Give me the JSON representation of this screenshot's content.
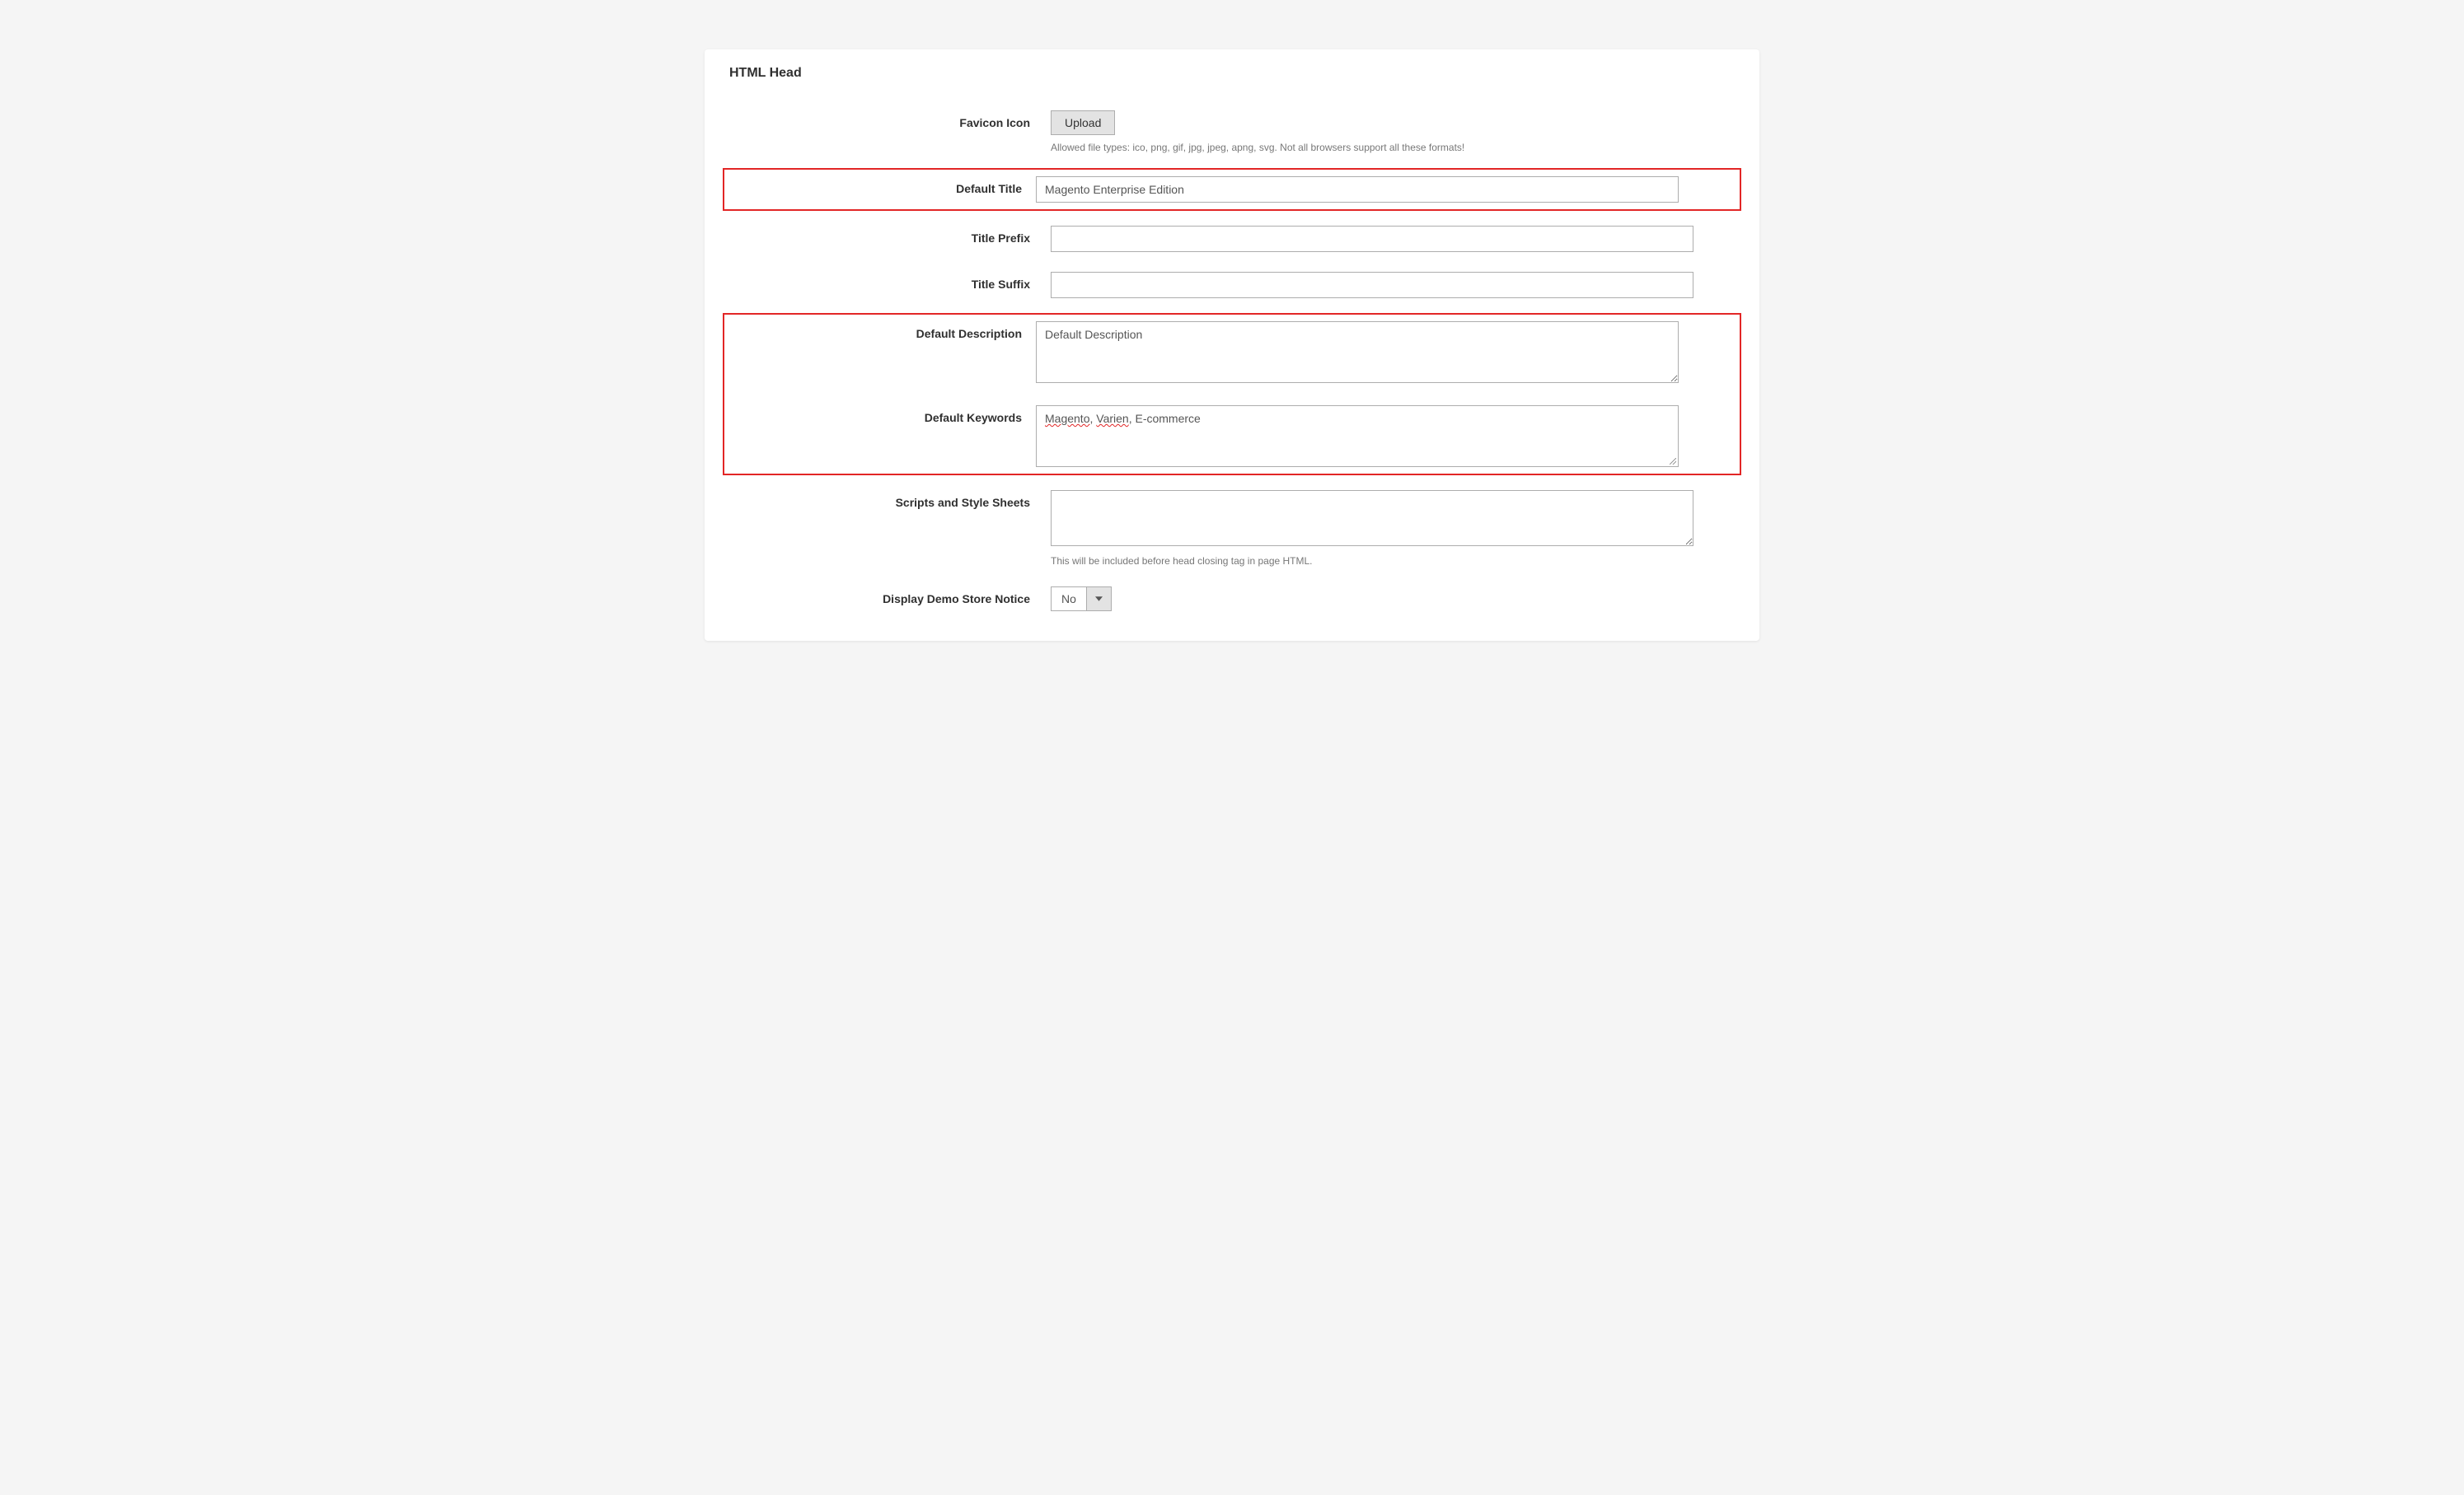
{
  "panel": {
    "title": "HTML Head"
  },
  "fields": {
    "favicon": {
      "label": "Favicon Icon",
      "button": "Upload",
      "help": "Allowed file types: ico, png, gif, jpg, jpeg, apng, svg. Not all browsers support all these formats!"
    },
    "default_title": {
      "label": "Default Title",
      "value": "Magento Enterprise Edition"
    },
    "title_prefix": {
      "label": "Title Prefix",
      "value": ""
    },
    "title_suffix": {
      "label": "Title Suffix",
      "value": ""
    },
    "default_description": {
      "label": "Default Description",
      "value": "Default Description"
    },
    "default_keywords": {
      "label": "Default Keywords",
      "value": "Magento, Varien, E-commerce",
      "word1": "Magento",
      "sep1": ", ",
      "word2": "Varien",
      "sep2": ", E-commerce"
    },
    "scripts": {
      "label": "Scripts and Style Sheets",
      "value": "",
      "help": "This will be included before head closing tag in page HTML."
    },
    "demo_notice": {
      "label": "Display Demo Store Notice",
      "value": "No"
    }
  }
}
